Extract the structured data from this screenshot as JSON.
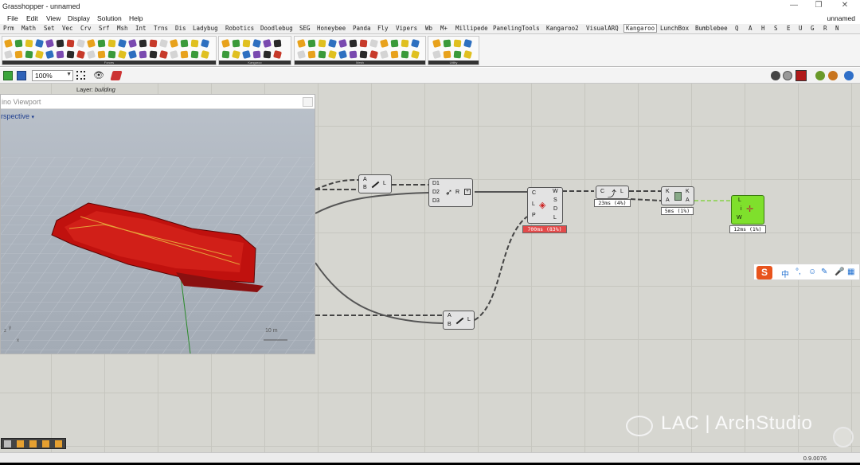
{
  "window": {
    "title": "Grasshopper - unnamed",
    "doc_name": "unnamed",
    "controls": [
      "—",
      "❐",
      "✕"
    ]
  },
  "menu": [
    "File",
    "Edit",
    "View",
    "Display",
    "Solution",
    "Help"
  ],
  "tabs": [
    "Prm",
    "Math",
    "Set",
    "Vec",
    "Crv",
    "Srf",
    "Msh",
    "Int",
    "Trns",
    "Dis",
    "Ladybug",
    "Robotics",
    "Doodlebug",
    "SEG",
    "Honeybee",
    "Panda",
    "Fly",
    "Vipers",
    "Wb",
    "M+",
    "Millipede",
    "PanelingTools",
    "Kangaroo2",
    "VisualARQ",
    "Kangaroo",
    "LunchBox",
    "Bumblebee",
    "Q",
    "A",
    "H",
    "S",
    "E",
    "U",
    "G",
    "R",
    "N"
  ],
  "active_tab": "Kangaroo",
  "ribbon_panels": [
    {
      "caption": "Forces"
    },
    {
      "caption": "Kangaroo"
    },
    {
      "caption": "Mesh"
    },
    {
      "caption": "Utility"
    }
  ],
  "toolbar": {
    "zoom": "100%",
    "layer_label": "Layer:",
    "layer_value": "building"
  },
  "viewport": {
    "title": "ino Viewport",
    "view_name": "rspective",
    "scale_label": "10 m",
    "axis_x": "x",
    "axis_y": "y",
    "axis_z": "z"
  },
  "components": {
    "line1": {
      "in": [
        "A",
        "B"
      ],
      "out": [
        "L"
      ]
    },
    "divide": {
      "in": [
        "D1",
        "D2",
        "D3"
      ],
      "mid": "R"
    },
    "solver": {
      "in": [
        "C",
        "L",
        "P"
      ],
      "out": [
        "W",
        "S",
        "D",
        "L"
      ],
      "timer": "700ms (83%)"
    },
    "curve": {
      "in": [
        "C"
      ],
      "out": [
        "L"
      ],
      "timer": "23ms (4%)"
    },
    "keys": {
      "in": [
        "K",
        "A"
      ],
      "out": [
        "K",
        "A"
      ],
      "timer": "5ms (1%)"
    },
    "final": {
      "in": [
        "L",
        "W"
      ],
      "mid": "i",
      "timer": "12ms (1%)"
    },
    "line2": {
      "in": [
        "A",
        "B"
      ],
      "out": [
        "L"
      ]
    }
  },
  "ime": {
    "logo": "S",
    "glyphs": [
      "中",
      "°,",
      "☺",
      "✎",
      "🎤",
      "▦"
    ]
  },
  "watermark": "LAC | ArchStudio",
  "version": "0.9.0076",
  "colors": {
    "canvas": "#d6d6d0",
    "grid": "#c6c6bf",
    "timer_hot": "#e34a4a",
    "green_component": "#7fe02c",
    "geometry_red": "#c0110e",
    "active_tab_border": "#999999"
  }
}
